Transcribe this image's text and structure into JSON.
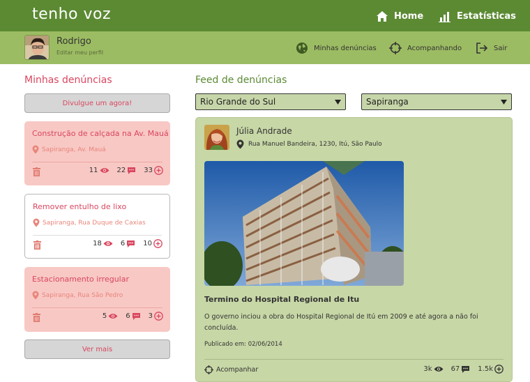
{
  "app": {
    "brand": "tenho voz"
  },
  "topnav": {
    "home": "Home",
    "stats": "Estatísticas"
  },
  "user": {
    "name": "Rodrigo",
    "edit": "Editar meu perfil"
  },
  "subnav": {
    "mine": "Minhas denúncias",
    "following": "Acompanhando",
    "logout": "Sair"
  },
  "left": {
    "heading": "Minhas denúncias",
    "cta": "Divulgue um agora!",
    "more": "Ver mais",
    "cards": [
      {
        "title": "Construção de calçada na Av. Mauá",
        "location": "Sapiranga, Av. Mauá",
        "views": "11",
        "comments": "22",
        "plus": "33"
      },
      {
        "title": "Remover entulho de lixo",
        "location": "Sapiranga, Rua Duque de Caxias",
        "views": "18",
        "comments": "6",
        "plus": "10"
      },
      {
        "title": "Estacionamento irregular",
        "location": "Sapiranga, Rua São Pedro",
        "views": "5",
        "comments": "6",
        "plus": "3"
      }
    ]
  },
  "feed": {
    "heading": "Feed de denúncias",
    "state": "Rio Grande do Sul",
    "city": "Sapiranga",
    "post": {
      "author": "Júlia Andrade",
      "address": "Rua Manuel Bandeira, 1230, Itú, São Paulo",
      "title": "Termino do Hospital Regional de Itu",
      "description": "O governo inciou a obra do Hospital Regional de Itú em 2009 e até agora a não foi concluída.",
      "published": "Publicado em: 02/06/2014",
      "follow": "Acompanhar",
      "views": "3k",
      "comments": "67",
      "plus": "1.5k"
    }
  },
  "colors": {
    "green_dark": "#5b8a33",
    "green_light": "#9cbc63",
    "pink": "#f8c8c4",
    "red": "#d9465f",
    "feed_bg": "#c7d7a6"
  }
}
